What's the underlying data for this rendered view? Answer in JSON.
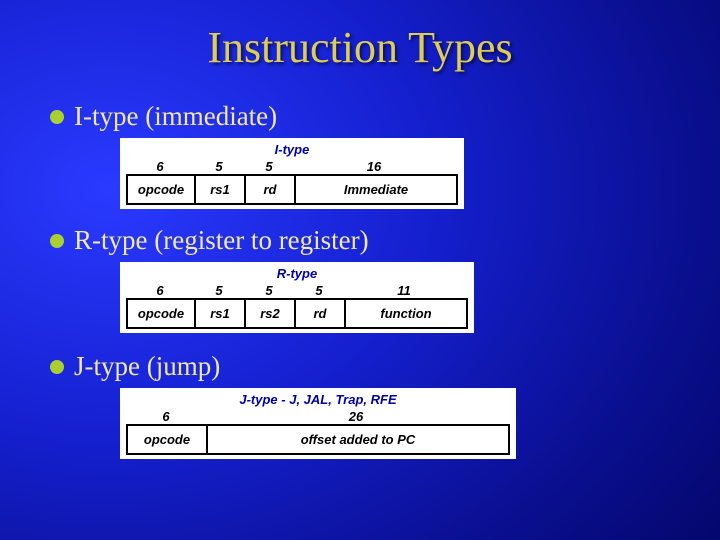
{
  "title": "Instruction Types",
  "sections": {
    "i": {
      "bullet": "I-type  (immediate)",
      "diag_title": "I-type",
      "bits": [
        "6",
        "5",
        "5",
        "16"
      ],
      "fields": [
        "opcode",
        "rs1",
        "rd",
        "Immediate"
      ]
    },
    "r": {
      "bullet": "R-type  (register to register)",
      "diag_title": "R-type",
      "bits": [
        "6",
        "5",
        "5",
        "5",
        "11"
      ],
      "fields": [
        "opcode",
        "rs1",
        "rs2",
        "rd",
        "function"
      ]
    },
    "j": {
      "bullet": "J-type  (jump)",
      "diag_title": "J-type - J, JAL, Trap, RFE",
      "bits": [
        "6",
        "26"
      ],
      "fields": [
        "opcode",
        "offset added to PC"
      ]
    }
  }
}
